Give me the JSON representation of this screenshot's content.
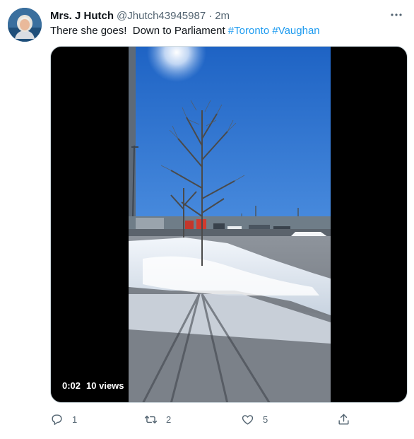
{
  "tweet": {
    "display_name": "Mrs. J Hutch",
    "handle": "@Jhutch43945987",
    "separator": "·",
    "time": "2m",
    "text": "There she goes!  Down to Parliament ",
    "hashtags": [
      "#Toronto",
      "#Vaughan"
    ],
    "more_icon": "more-horizontal-icon"
  },
  "media": {
    "elapsed": "0:02",
    "views": "10 views"
  },
  "actions": {
    "reply_count": "1",
    "retweet_count": "2",
    "like_count": "5",
    "icons": [
      "reply-icon",
      "retweet-icon",
      "like-icon",
      "share-icon"
    ]
  },
  "colors": {
    "accent": "#1d9bf0",
    "secondary_text": "#536471",
    "primary_text": "#0f1419"
  }
}
